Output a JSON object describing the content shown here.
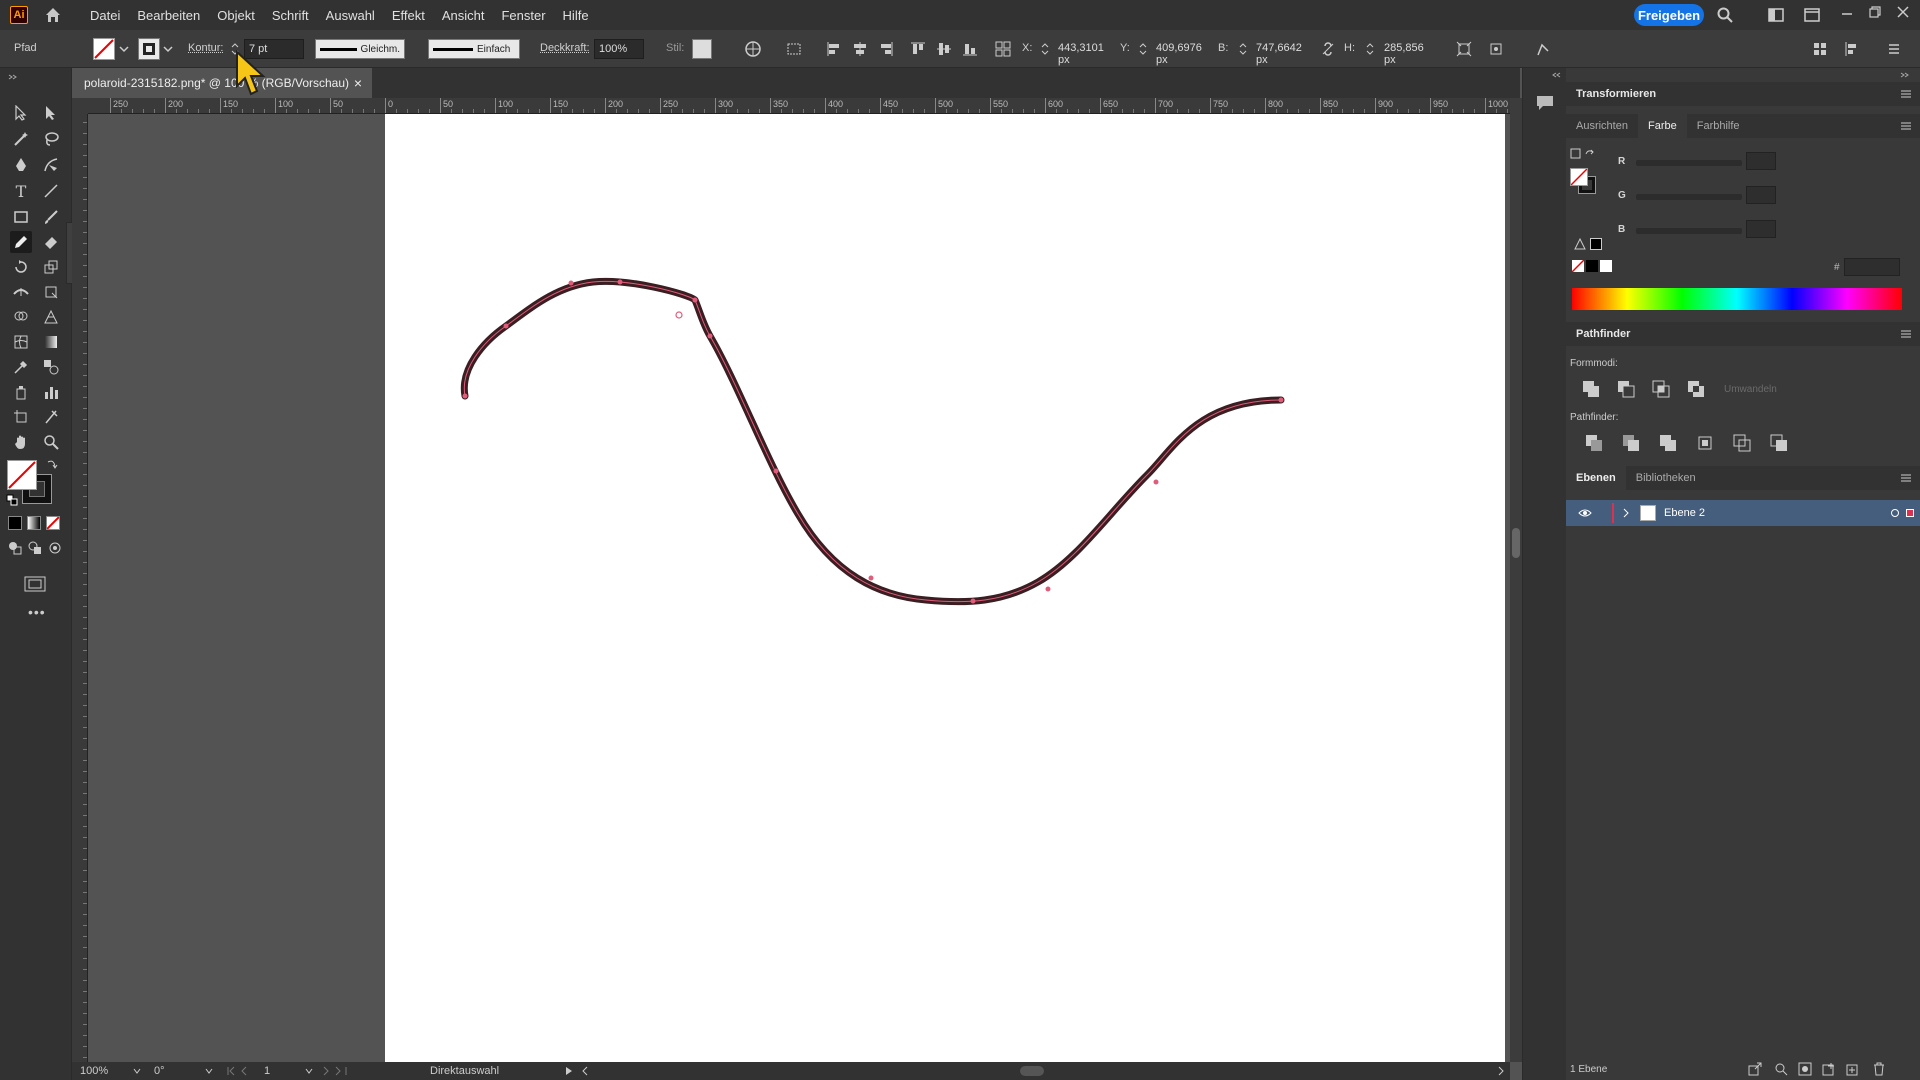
{
  "app": {
    "logo": "Ai",
    "share_label": "Freigeben"
  },
  "menu": [
    "Datei",
    "Bearbeiten",
    "Objekt",
    "Schrift",
    "Auswahl",
    "Effekt",
    "Ansicht",
    "Fenster",
    "Hilfe"
  ],
  "control_bar": {
    "object_type": "Pfad",
    "stroke_label": "Kontur:",
    "stroke_weight": "7 pt",
    "profile_label": "Gleichm.",
    "brush_label": "Einfach",
    "opacity_label": "Deckkraft:",
    "opacity_value": "100%",
    "style_label": "Stil:",
    "x_label": "X:",
    "x_value": "443,3101 px",
    "y_label": "Y:",
    "y_value": "409,6976 px",
    "w_label": "B:",
    "w_value": "747,6642 px",
    "h_label": "H:",
    "h_value": "285,856 px"
  },
  "document_tab": {
    "title": "polaroid-2315182.png* @ 100 % (RGB/Vorschau)",
    "close": "×"
  },
  "ruler_h_ticks": [
    "250",
    "200",
    "150",
    "100",
    "50",
    "0",
    "50",
    "100",
    "150",
    "200",
    "250",
    "300",
    "350",
    "400",
    "450",
    "500",
    "550",
    "600",
    "650",
    "700",
    "750",
    "800",
    "850",
    "900",
    "950",
    "1000"
  ],
  "status_bar": {
    "zoom": "100%",
    "rotation": "0°",
    "artboard": "1",
    "tool": "Direktauswahl"
  },
  "panels": {
    "transform_title": "Transformieren",
    "tabs": [
      "Ausrichten",
      "Farbe",
      "Farbhilfe"
    ],
    "active_tab": "Farbe",
    "color_channels": [
      "R",
      "G",
      "B"
    ],
    "hex_prefix": "#",
    "pathfinder_title": "Pathfinder",
    "shape_modes_label": "Formmodi:",
    "expand_label": "Umwandeln",
    "pathfinder_label": "Pathfinder:",
    "layers_tabs": [
      "Ebenen",
      "Bibliotheken"
    ],
    "layer_name": "Ebene 2",
    "layers_count": "1 Ebene"
  },
  "colors": {
    "accent": "#1473e6",
    "stroke_path": "#3a1e22",
    "anchor": "#e05c7a",
    "layer_highlight": "#465e7d"
  }
}
